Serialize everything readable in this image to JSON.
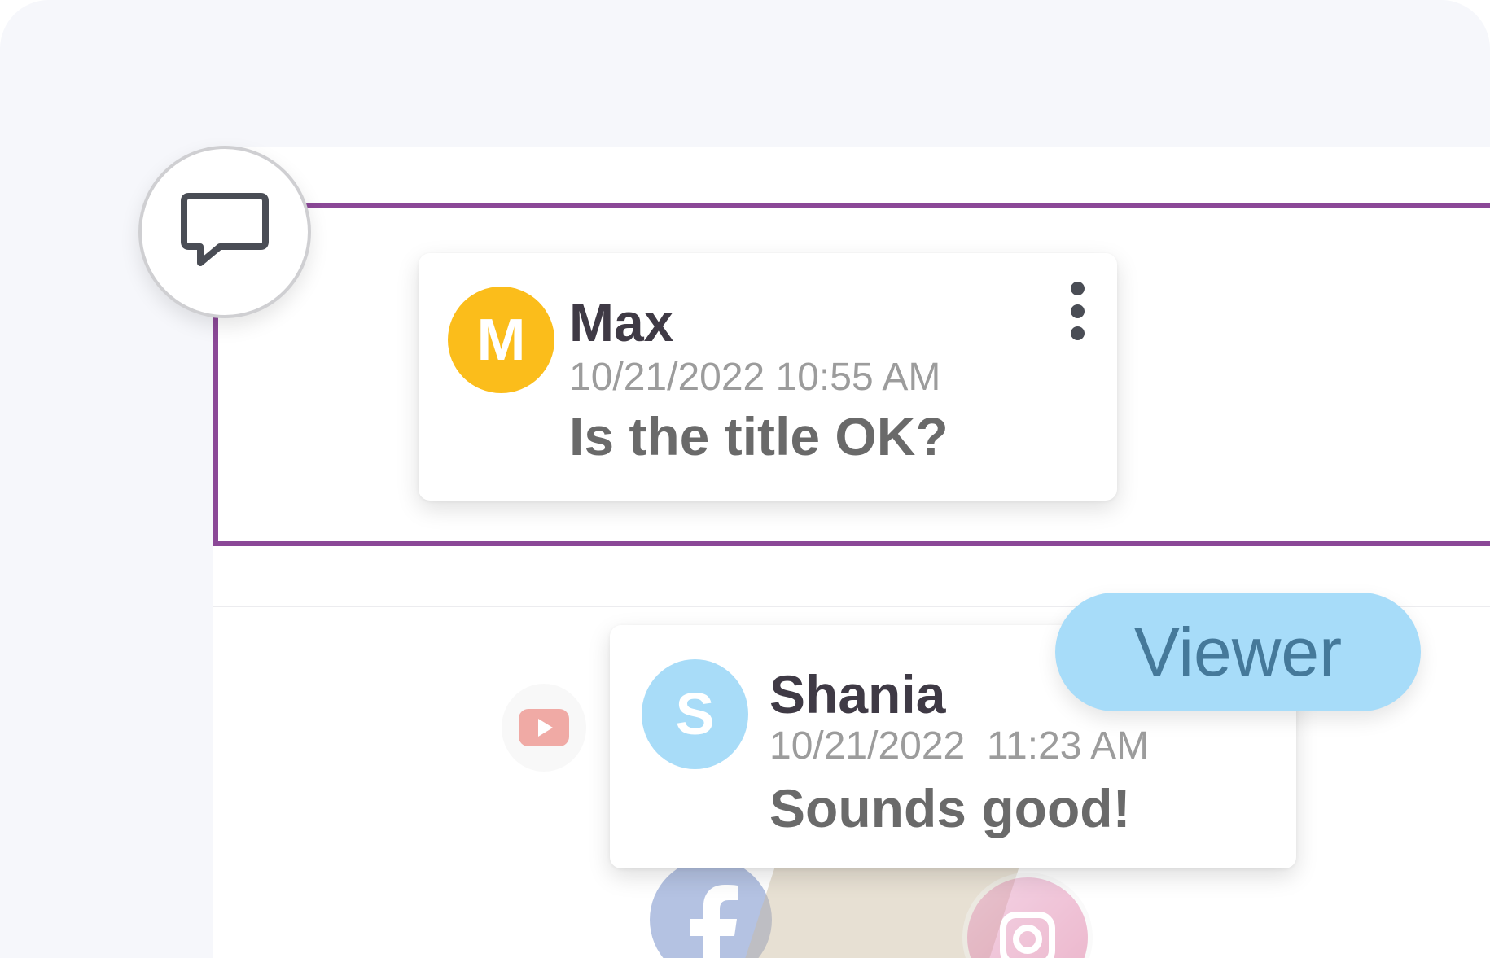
{
  "comments": [
    {
      "avatar_initial": "M",
      "avatar_color": "#fbbd1b",
      "author": "Max",
      "timestamp": "10/21/2022 10:55 AM",
      "text": "Is the title OK?"
    },
    {
      "avatar_initial": "S",
      "avatar_color": "#a8dcf8",
      "author": "Shania",
      "timestamp": "10/21/2022  11:23 AM",
      "text": "Sounds good!"
    }
  ],
  "role_badge": {
    "label": "Viewer",
    "bg_color": "#a7dcf9",
    "text_color": "#45799a"
  },
  "selection_color": "#8b4897",
  "icons": {
    "comment_button": "speech-bubble-icon",
    "menu": "kebab-menu-icon",
    "social": [
      "youtube-icon",
      "facebook-icon",
      "instagram-icon"
    ]
  }
}
